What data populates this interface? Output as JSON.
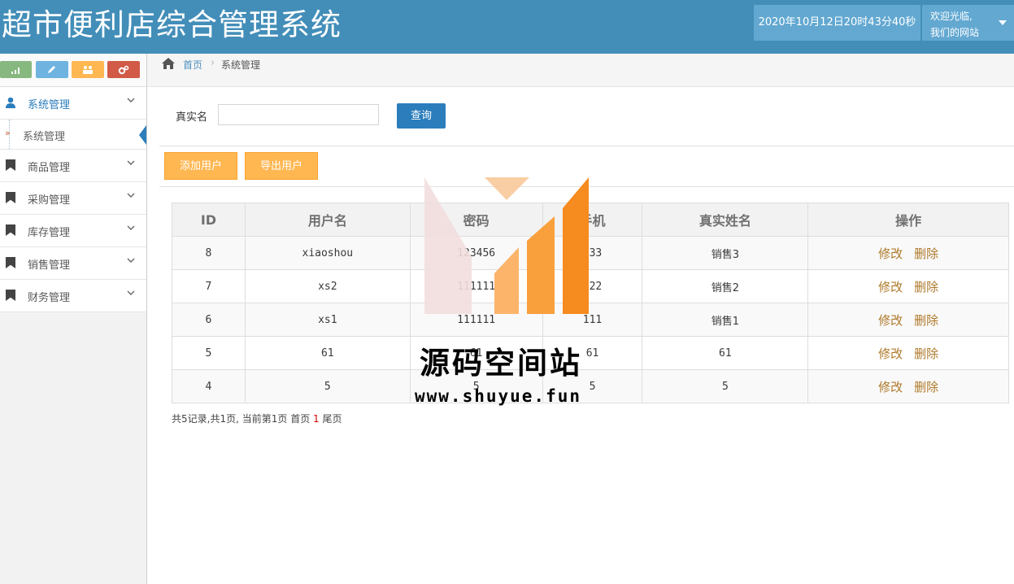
{
  "header": {
    "app_title": "超市便利店综合管理系统",
    "datetime": "2020年10月12日20时43分40秒",
    "welcome_line1": "欢迎光临,",
    "welcome_line2": "我们的网站"
  },
  "shortcuts": [
    {
      "icon": "signal-icon",
      "color": "#87b87f"
    },
    {
      "icon": "pencil-icon",
      "color": "#6fb3e0"
    },
    {
      "icon": "users-icon",
      "color": "#ffb752"
    },
    {
      "icon": "cogs-icon",
      "color": "#d15b47"
    }
  ],
  "sidebar": {
    "items": [
      {
        "label": "系统管理",
        "icon": "user-icon",
        "expanded": true
      },
      {
        "label": "商品管理",
        "icon": "bookmark-icon"
      },
      {
        "label": "采购管理",
        "icon": "bookmark-icon"
      },
      {
        "label": "库存管理",
        "icon": "bookmark-icon"
      },
      {
        "label": "销售管理",
        "icon": "bookmark-icon"
      },
      {
        "label": "财务管理",
        "icon": "bookmark-icon"
      }
    ],
    "sub_item": {
      "label": "系统管理",
      "active": true
    }
  },
  "breadcrumb": {
    "home": "首页",
    "current": "系统管理"
  },
  "search": {
    "label": "真实名",
    "value": "",
    "button": "查询"
  },
  "toolbar": {
    "add_label": "添加用户",
    "export_label": "导出用户"
  },
  "table": {
    "headers": [
      "ID",
      "用户名",
      "密码",
      "手机",
      "真实姓名",
      "操作"
    ],
    "rows": [
      {
        "id": "8",
        "username": "xiaoshou",
        "password": "123456",
        "phone": "333",
        "realname": "销售3"
      },
      {
        "id": "7",
        "username": "xs2",
        "password": "111111",
        "phone": "222",
        "realname": "销售2"
      },
      {
        "id": "6",
        "username": "xs1",
        "password": "111111",
        "phone": "111",
        "realname": "销售1"
      },
      {
        "id": "5",
        "username": "61",
        "password": "61",
        "phone": "61",
        "realname": "61"
      },
      {
        "id": "4",
        "username": "5",
        "password": "5",
        "phone": "5",
        "realname": "5"
      }
    ],
    "edit_label": "修改",
    "delete_label": "删除"
  },
  "pager": {
    "summary": "共5记录,共1页, 当前第1页",
    "first": "首页",
    "current_page": "1",
    "last": "尾页"
  },
  "watermark": {
    "text": "源码空间站",
    "url": "www.shuyue.fun"
  },
  "colors": {
    "header": "#438eb9",
    "primary_button": "#2b7dbc",
    "warning_button": "#ffb752",
    "action_link": "#ae7929"
  }
}
